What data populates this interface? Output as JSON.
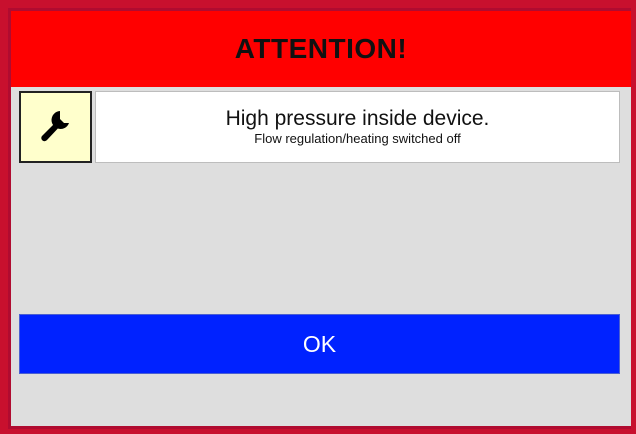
{
  "dialog": {
    "title": "ATTENTION!",
    "icon": "wrench-icon",
    "message": "High pressure inside device.",
    "detail": "Flow regulation/heating switched off",
    "ok_label": "OK"
  },
  "colors": {
    "frame": "#c8102e",
    "title_bar": "#ff0000",
    "icon_background": "#ffffcc",
    "ok_button": "#0022ff",
    "dialog_background": "#dedede"
  }
}
